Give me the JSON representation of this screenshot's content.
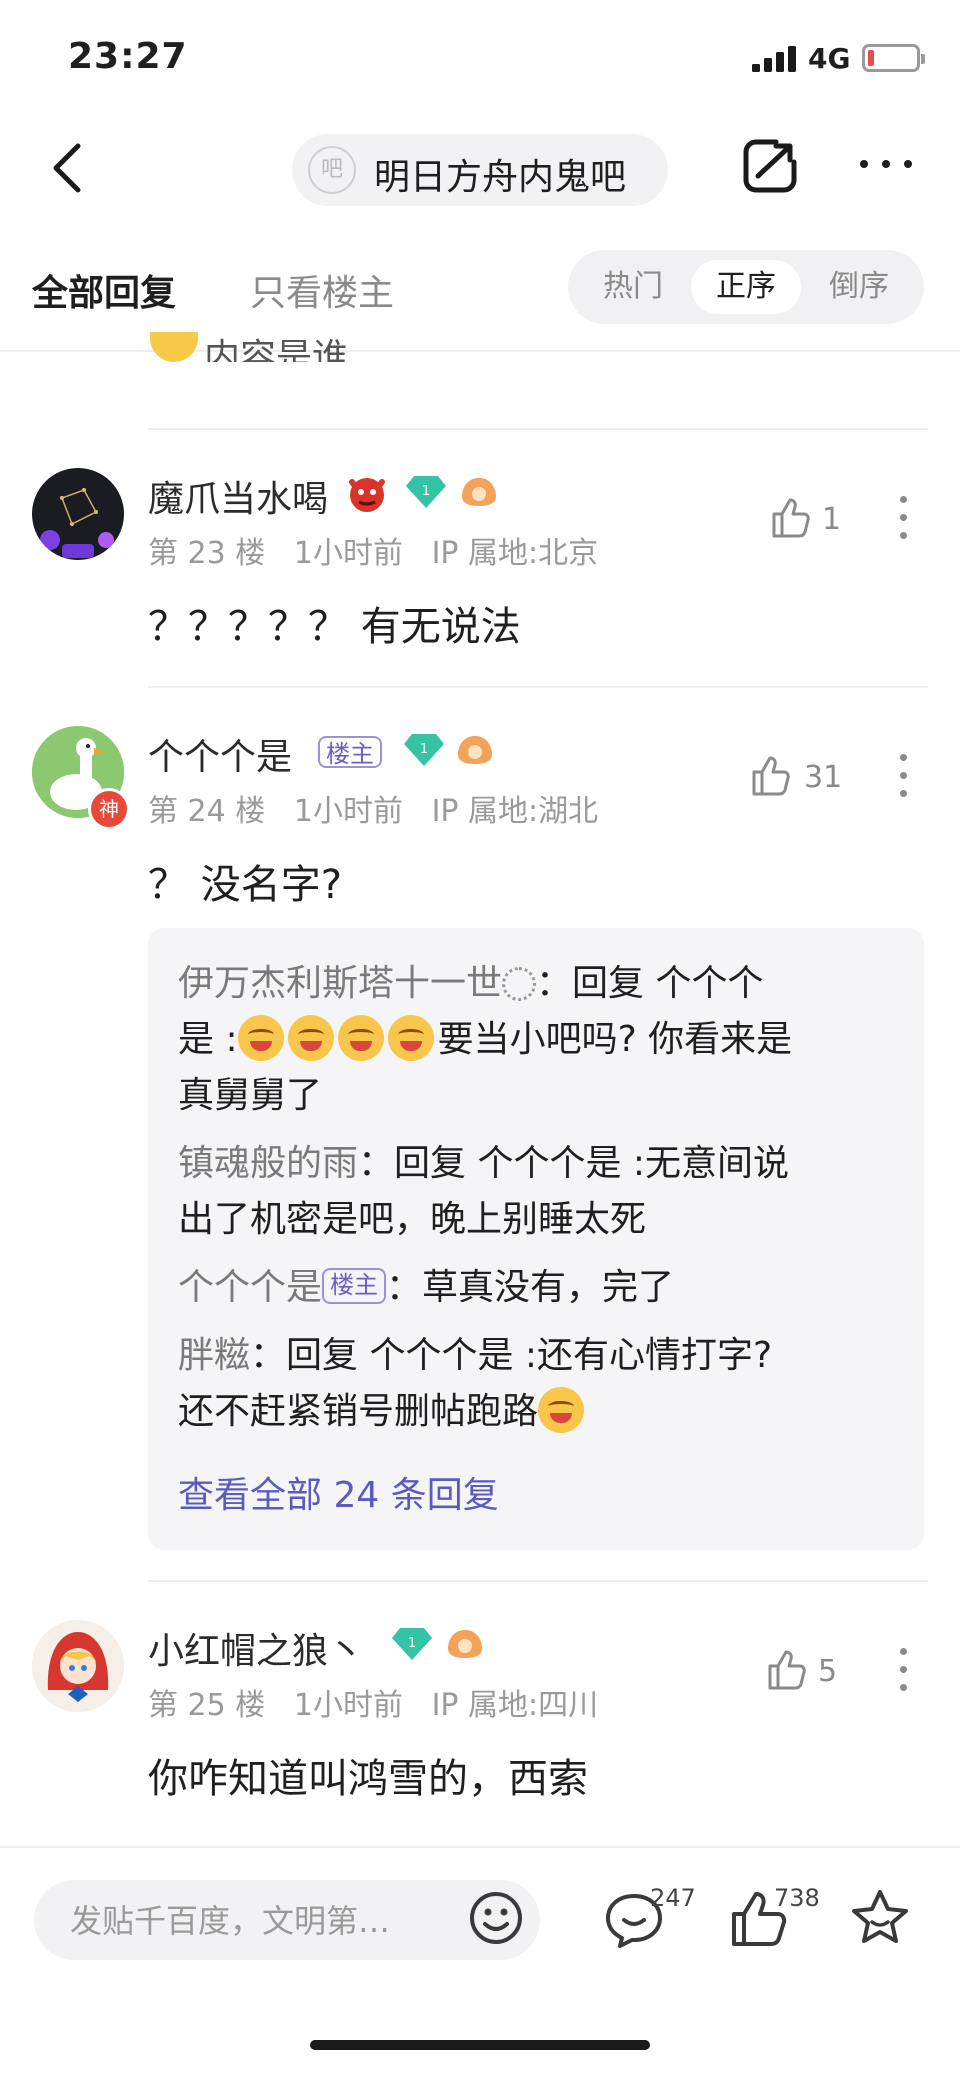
{
  "status": {
    "time": "23:27",
    "network": "4G"
  },
  "header": {
    "forum_logo_text": "吧",
    "forum_name": "明日方舟内鬼吧"
  },
  "tabs": {
    "all": "全部回复",
    "op_only": "只看楼主",
    "sort": {
      "hot": "热门",
      "asc": "正序",
      "desc": "倒序",
      "active": "正序"
    }
  },
  "partial": {
    "text": "内容是谁"
  },
  "posts": [
    {
      "username": "魔爪当水喝",
      "floor": "第 23 楼",
      "time": "1小时前",
      "ip": "IP 属地:北京",
      "likes": "1",
      "text": "？？？？？ 有无说法",
      "level": "1"
    },
    {
      "username": "个个个是",
      "op_tag": "楼主",
      "floor": "第 24 楼",
      "time": "1小时前",
      "ip": "IP 属地:湖北",
      "likes": "31",
      "text": "？ 没名字?",
      "level": "1",
      "avatar_badge": "神"
    },
    {
      "username": "小红帽之狼丶",
      "floor": "第 25 楼",
      "time": "1小时前",
      "ip": "IP 属地:四川",
      "likes": "5",
      "text": "你咋知道叫鸿雪的，西索",
      "level": "1"
    }
  ],
  "replies": {
    "r1": {
      "name": "伊万杰利斯塔十一世",
      "a": "：回复 个个个",
      "b1": "是 :",
      "b2": "要当小吧吗? 你看来是",
      "c": "真舅舅了"
    },
    "r2": {
      "name": "镇魂般的雨",
      "a": "：回复 个个个是 :无意间说",
      "b": "出了机密是吧，晚上别睡太死"
    },
    "r3": {
      "name": "个个个是",
      "tag": "楼主",
      "a": "：草真没有，完了"
    },
    "r4": {
      "name": "胖糍",
      "a": "：回复 个个个是 :还有心情打字?",
      "b": "还不赶紧销号删帖跑路"
    },
    "view_all": "查看全部 24 条回复"
  },
  "bottom": {
    "input_placeholder": "发贴千百度，文明第…",
    "comments": "247",
    "likes": "738"
  },
  "colors": {
    "accent": "#5b5bbf",
    "op_tag": "#6b5fc4",
    "gem": "#35c3a5",
    "gray_text": "#9a9a9a"
  },
  "icons": [
    "back-icon",
    "share-icon",
    "more-icon",
    "like-icon",
    "kebab-icon",
    "emoji-icon",
    "comment-icon",
    "star-icon",
    "gem-badge-icon",
    "lion-badge-icon",
    "devil-emoji-icon"
  ]
}
